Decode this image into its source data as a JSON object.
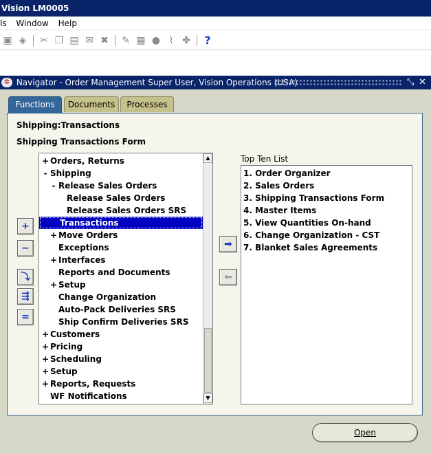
{
  "app": {
    "title": "Vision LM0005"
  },
  "menubar": {
    "items": [
      "ls",
      "Window",
      "Help"
    ]
  },
  "toolbar": {
    "help_glyph": "?"
  },
  "navigator": {
    "title": "Navigator - Order Management Super User, Vision Operations (USA)",
    "tabs": [
      "Functions",
      "Documents",
      "Processes"
    ],
    "active_tab": "Functions",
    "heading_path": "Shipping:Transactions",
    "heading_form": "Shipping Transactions Form",
    "tree": [
      {
        "exp": "+",
        "label": "Orders, Returns",
        "level": 0
      },
      {
        "exp": "-",
        "label": "Shipping",
        "level": 0
      },
      {
        "exp": "-",
        "label": "Release Sales Orders",
        "level": 1
      },
      {
        "exp": "",
        "label": "Release Sales Orders",
        "level": 2
      },
      {
        "exp": "",
        "label": "Release Sales Orders SRS",
        "level": 2
      },
      {
        "exp": "",
        "label": "Transactions",
        "level": 1,
        "selected": true
      },
      {
        "exp": "+",
        "label": "Move Orders",
        "level": 1
      },
      {
        "exp": "",
        "label": "Exceptions",
        "level": 1
      },
      {
        "exp": "+",
        "label": "Interfaces",
        "level": 1
      },
      {
        "exp": "",
        "label": "Reports and Documents",
        "level": 1
      },
      {
        "exp": "+",
        "label": "Setup",
        "level": 1
      },
      {
        "exp": "",
        "label": "Change Organization",
        "level": 1
      },
      {
        "exp": "",
        "label": "Auto-Pack Deliveries SRS",
        "level": 1
      },
      {
        "exp": "",
        "label": "Ship Confirm Deliveries SRS",
        "level": 1
      },
      {
        "exp": "+",
        "label": "Customers",
        "level": 0
      },
      {
        "exp": "+",
        "label": "Pricing",
        "level": 0
      },
      {
        "exp": "+",
        "label": "Scheduling",
        "level": 0
      },
      {
        "exp": "+",
        "label": "Setup",
        "level": 0
      },
      {
        "exp": "+",
        "label": "Reports, Requests",
        "level": 0
      },
      {
        "exp": "",
        "label": "WF Notifications",
        "level": 0
      }
    ],
    "top_ten_label": "Top Ten List",
    "top_ten": [
      "1. Order Organizer",
      "2. Sales Orders",
      "3. Shipping Transactions Form",
      "4. Master Items",
      "5. View Quantities On-hand",
      "6. Change Organization - CST",
      "7. Blanket Sales Agreements"
    ],
    "open_label": "Open",
    "colors": {
      "titlebar": "#0a246a",
      "tab_active": "#336699",
      "tab_inactive": "#c6c08a",
      "selection": "#0000c0"
    }
  }
}
